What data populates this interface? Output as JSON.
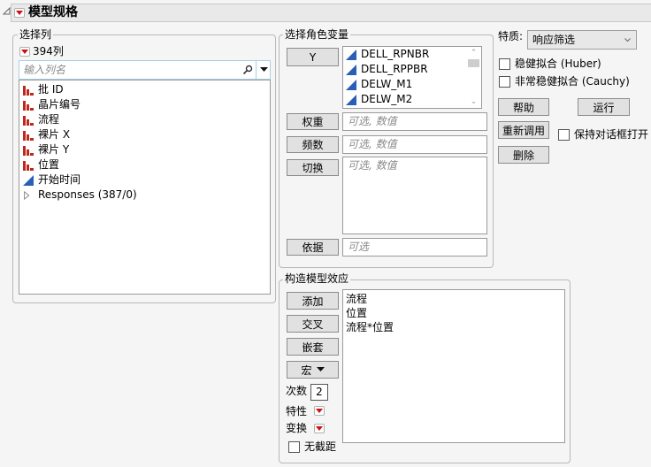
{
  "header": {
    "title": "模型规格"
  },
  "select_columns": {
    "group_label": "选择列",
    "column_count": "394列",
    "search_placeholder": "输入列名",
    "items": [
      {
        "label": "批 ID",
        "icon": "nominal-bar-icon"
      },
      {
        "label": "晶片编号",
        "icon": "nominal-bar-icon"
      },
      {
        "label": "流程",
        "icon": "nominal-bar-icon"
      },
      {
        "label": "裸片 X",
        "icon": "nominal-bar-icon"
      },
      {
        "label": "裸片 Y",
        "icon": "nominal-bar-icon"
      },
      {
        "label": "位置",
        "icon": "nominal-bar-icon"
      },
      {
        "label": "开始时间",
        "icon": "continuous-triangle-icon"
      },
      {
        "label": "Responses (387/0)",
        "icon": "expand-triangle-icon"
      }
    ]
  },
  "roles": {
    "group_label": "选择角色变量",
    "y_button": "Y",
    "y_values": [
      "DELL_RPNBR",
      "DELL_RPPBR",
      "DELW_M1",
      "DELW_M2"
    ],
    "weight_button": "权重",
    "weight_placeholder": "可选, 数值",
    "freq_button": "频数",
    "freq_placeholder": "可选, 数值",
    "by_switch_button": "切换",
    "switch_placeholder": "可选, 数值",
    "by_button": "依据",
    "by_placeholder": "可选"
  },
  "options": {
    "personality_label": "特质:",
    "personality_value": "响应筛选",
    "huber_label": "稳健拟合 (Huber)",
    "huber_checked": false,
    "cauchy_label": "非常稳健拟合 (Cauchy)",
    "cauchy_checked": false,
    "help_button": "帮助",
    "run_button": "运行",
    "recall_button": "重新调用",
    "keep_open_label": "保持对话框打开",
    "keep_open_checked": false,
    "remove_button": "删除"
  },
  "effects": {
    "group_label": "构造模型效应",
    "add_button": "添加",
    "cross_button": "交叉",
    "nest_button": "嵌套",
    "macros_button": "宏",
    "degree_label": "次数",
    "degree_value": "2",
    "attributes_label": "特性",
    "transform_label": "变换",
    "no_intercept_label": "无截距",
    "no_intercept_checked": false,
    "items": [
      "流程",
      "位置",
      "流程*位置"
    ]
  }
}
